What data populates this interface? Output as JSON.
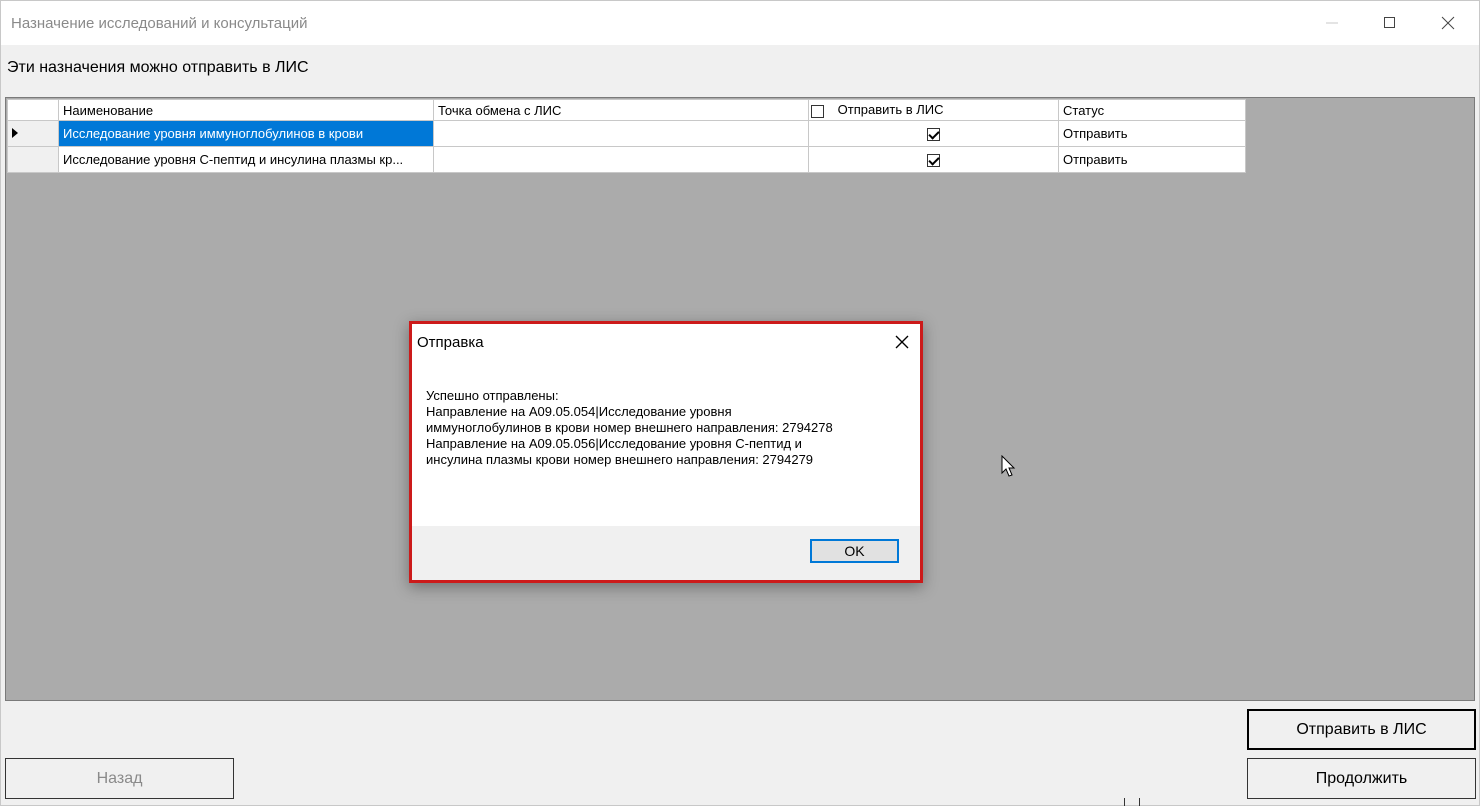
{
  "window": {
    "title": "Назначение исследований и консультаций"
  },
  "subtitle": "Эти назначения можно отправить в ЛИС",
  "grid": {
    "columns": {
      "name": "Наименование",
      "exchange_point": "Точка обмена с ЛИС",
      "send_to_lis": "Отправить в ЛИС",
      "status": "Статус"
    },
    "header_checkbox_checked": false,
    "rows": [
      {
        "name": "Исследование уровня иммуноглобулинов в крови",
        "exchange_point": "",
        "send_to_lis": true,
        "status": "Отправить",
        "selected": true
      },
      {
        "name": "Исследование уровня С-пептид и инсулина плазмы кр...",
        "exchange_point": "",
        "send_to_lis": true,
        "status": "Отправить",
        "selected": false
      }
    ]
  },
  "dialog": {
    "title": "Отправка",
    "lines": [
      "Успешно отправлены:",
      "Направление на A09.05.054|Исследование уровня",
      "иммуноглобулинов в крови номер внешнего направления: 2794278",
      "Направление на A09.05.056|Исследование уровня С-пептид и",
      "инсулина плазмы крови номер внешнего направления: 2794279"
    ],
    "ok_label": "OK"
  },
  "buttons": {
    "send_to_lis": "Отправить в ЛИС",
    "continue": "Продолжить",
    "back": "Назад"
  },
  "colors": {
    "selection": "#0078d7",
    "dialog_border": "#cc1a1a",
    "grid_background": "#ababab"
  },
  "icons": {
    "minimize": "minimize-icon",
    "maximize": "maximize-icon",
    "close": "close-icon",
    "row_indicator": "row-pointer-icon",
    "cursor": "mouse-pointer-icon"
  }
}
